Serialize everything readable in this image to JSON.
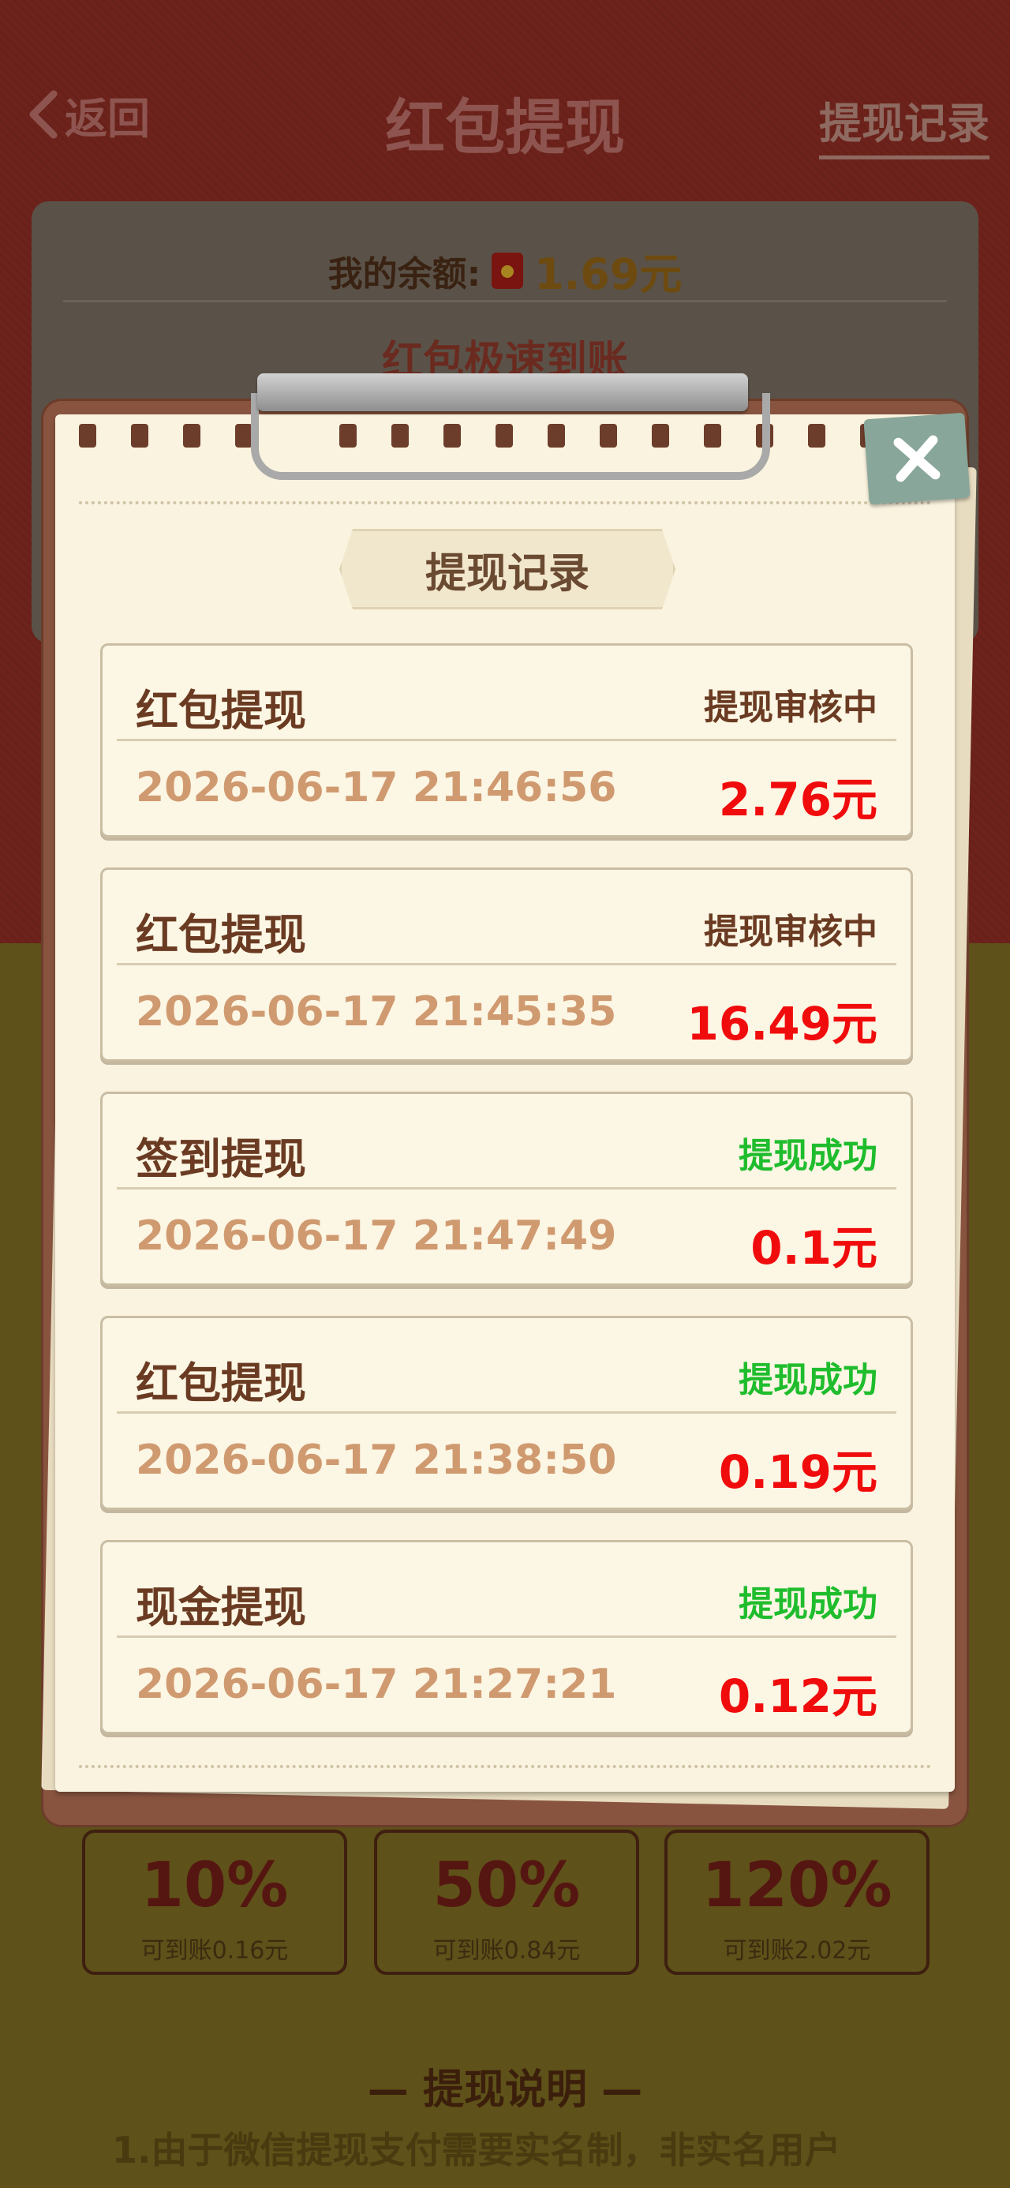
{
  "header": {
    "back_label": "返回",
    "title": "红包提现",
    "records_link": "提现记录"
  },
  "balance": {
    "label": "我的余额:",
    "amount": "1.69元",
    "sub_title": "红包极速到账"
  },
  "options": [
    {
      "percent": "10%",
      "sub": "可到账0.16元"
    },
    {
      "percent": "50%",
      "sub": "可到账0.84元"
    },
    {
      "percent": "120%",
      "sub": "可到账2.02元"
    }
  ],
  "explanation": {
    "title": "— 提现说明 —",
    "line1": "1.由于微信提现支付需要实名制，非实名用户"
  },
  "modal": {
    "title": "提现记录",
    "records": [
      {
        "type": "红包提现",
        "status": "提现审核中",
        "status_kind": "pending",
        "time": "2026-06-17 21:46:56",
        "amount": "2.76元"
      },
      {
        "type": "红包提现",
        "status": "提现审核中",
        "status_kind": "pending",
        "time": "2026-06-17 21:45:35",
        "amount": "16.49元"
      },
      {
        "type": "签到提现",
        "status": "提现成功",
        "status_kind": "success",
        "time": "2026-06-17 21:47:49",
        "amount": "0.1元"
      },
      {
        "type": "红包提现",
        "status": "提现成功",
        "status_kind": "success",
        "time": "2026-06-17 21:38:50",
        "amount": "0.19元"
      },
      {
        "type": "现金提现",
        "status": "提现成功",
        "status_kind": "success",
        "time": "2026-06-17 21:27:21",
        "amount": "0.12元"
      }
    ]
  },
  "colors": {
    "pending": "#6a3b22",
    "success": "#1fbd2d",
    "amount": "#f00c0c"
  }
}
